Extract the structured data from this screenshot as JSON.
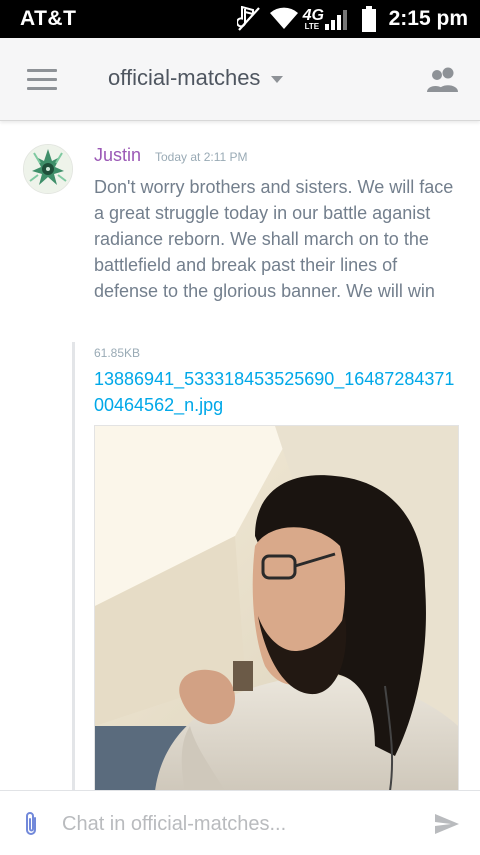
{
  "status": {
    "carrier": "AT&T",
    "network": "4G",
    "network_sub": "LTE",
    "time": "2:15 pm"
  },
  "toolbar": {
    "menu_icon": "hamburger-icon",
    "channel": "official-matches",
    "members_icon": "members-icon"
  },
  "message": {
    "author": "Justin",
    "author_color": "#9b59b6",
    "timestamp": "Today at 2:11 PM",
    "text": "Don't worry brothers and sisters. We will face a great struggle today in our battle aganist radiance reborn. We shall march on to the battlefield and break past their lines of defense to the glorious banner. We will win",
    "attachment": {
      "size": "61.85KB",
      "filename": "13886941_533318453525690_1648728437100464562_n.jpg",
      "link_color": "#00a8e8"
    }
  },
  "composer": {
    "placeholder": "Chat in official-matches...",
    "attach_icon": "paperclip-icon",
    "send_icon": "send-icon"
  }
}
